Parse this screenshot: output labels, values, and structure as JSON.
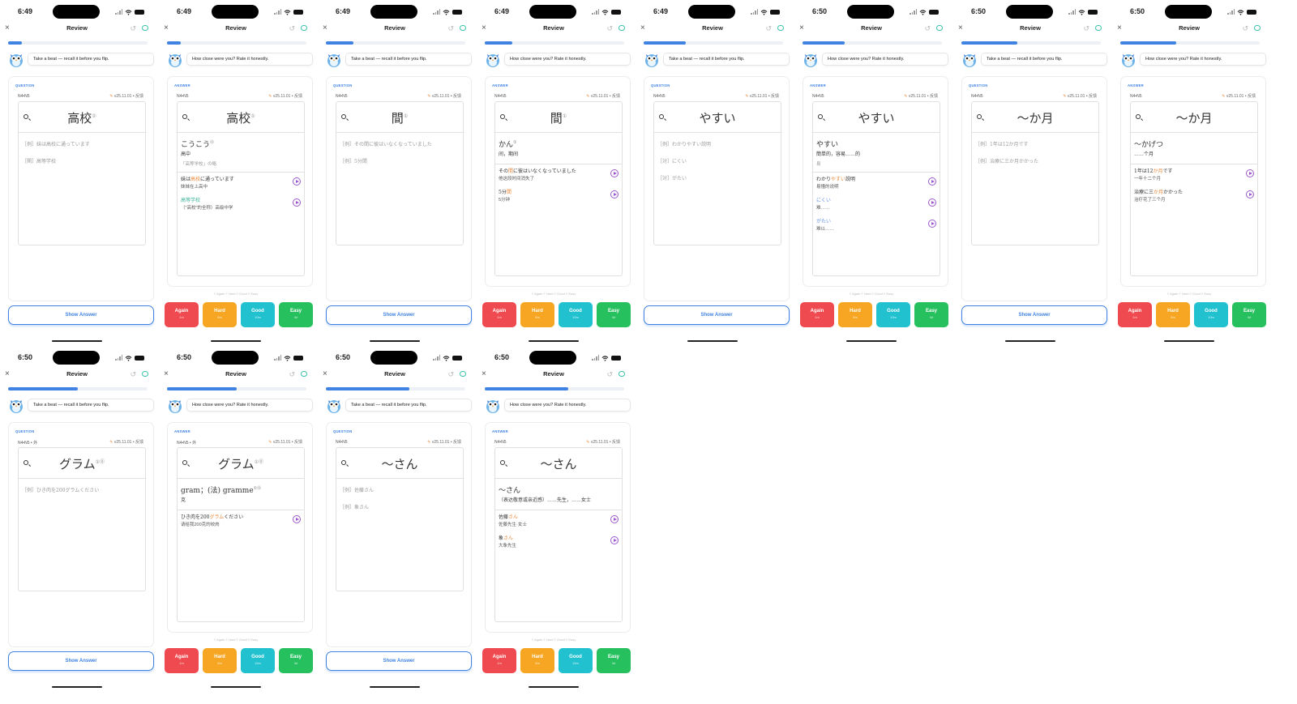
{
  "nav": {
    "title": "Review",
    "close": "×",
    "undo": "↺"
  },
  "prompts": {
    "question": "Take a beat — recall it before you flip.",
    "answer": "How close were you? Rate it honestly."
  },
  "labels": {
    "question": "QUESTION",
    "answer": "ANSWER",
    "show_answer": "Show Answer",
    "legend": "≡ Again  ≡ Hard  ≡ Good  ≡ Easy",
    "magnifier": "search"
  },
  "rating": [
    {
      "label": "Again",
      "interval": "1m"
    },
    {
      "label": "Hard",
      "interval": "6m"
    },
    {
      "label": "Good",
      "interval": "10m"
    },
    {
      "label": "Easy",
      "interval": "4d"
    }
  ],
  "colors": {
    "accent": "#3f82e2",
    "again": "#ef4a4f",
    "hard": "#f6a623",
    "good": "#22c1cf",
    "easy": "#27c05e",
    "highlight": "#e8883a",
    "play": "#9b59d0"
  },
  "screens": [
    {
      "side": "question",
      "time": "6:49",
      "progress": 0.1,
      "level": "N4•N5",
      "version": "v25.11.01 • 反馈",
      "word": "高校",
      "sup": "①",
      "examples": [
        "［例］妹は高校に通っています",
        "［関］高等学校"
      ]
    },
    {
      "side": "answer",
      "time": "6:49",
      "progress": 0.1,
      "level": "N4•N5",
      "version": "v25.11.01 • 反馈",
      "word": "高校",
      "sup": "①",
      "reading": "こうこう",
      "rsup": "⓪",
      "meaning": "高中",
      "note": "「高等学校」の略",
      "items": [
        {
          "jp_pre": "妹は",
          "jp_hl": "高校",
          "jp_post": "に通っています",
          "cn": "妹妹在上高中",
          "color": ""
        },
        {
          "jp_pre": "",
          "jp_hl": "",
          "jp_post": "高等学校",
          "cn": "（\"高校\"的全称）高级中学",
          "color": "grn"
        }
      ]
    },
    {
      "side": "question",
      "time": "6:49",
      "progress": 0.2,
      "level": "N4•N5",
      "version": "v25.11.01 • 反馈",
      "word": "間",
      "sup": "①",
      "examples": [
        "［例］その間に彼はいなくなっていました",
        "［例］5分間"
      ]
    },
    {
      "side": "answer",
      "time": "6:49",
      "progress": 0.2,
      "level": "N4•N5",
      "version": "v25.11.01 • 反馈",
      "word": "間",
      "sup": "①",
      "reading": "かん",
      "rsup": "①",
      "meaning": "间，期间",
      "note": "",
      "items": [
        {
          "jp_pre": "その",
          "jp_hl": "間",
          "jp_post": "に彼はいなくなっていました",
          "cn": "他这段时间消失了",
          "color": ""
        },
        {
          "jp_pre": "5分",
          "jp_hl": "間",
          "jp_post": "",
          "cn": "5分钟",
          "color": ""
        }
      ]
    },
    {
      "side": "question",
      "time": "6:49",
      "progress": 0.3,
      "level": "N4•N5",
      "version": "v25.11.01 • 反馈",
      "word": "やすい",
      "sup": "",
      "examples": [
        "［例］わかりやすい説明",
        "［対］にくい",
        "［対］がたい"
      ]
    },
    {
      "side": "answer",
      "time": "6:50",
      "progress": 0.3,
      "level": "N4•N5",
      "version": "v25.11.01 • 反馈",
      "word": "やすい",
      "sup": "",
      "reading": "やすい",
      "rsup": "",
      "meaning": "簡単的，容易……的",
      "note": "易",
      "items": [
        {
          "jp_pre": "わかり",
          "jp_hl": "やすい",
          "jp_post": "説明",
          "cn": "易懂的说明",
          "color": ""
        },
        {
          "jp_pre": "",
          "jp_hl": "",
          "jp_post": "にくい",
          "cn": "难……",
          "color": "blu"
        },
        {
          "jp_pre": "",
          "jp_hl": "",
          "jp_post": "がたい",
          "cn": "难以……",
          "color": "blu"
        }
      ]
    },
    {
      "side": "question",
      "time": "6:50",
      "progress": 0.4,
      "level": "N4•N5",
      "version": "v25.11.01 • 反馈",
      "word": "～か月",
      "sup": "",
      "examples": [
        "［例］1年は12か月です",
        "［例］治療に三か月かかった"
      ]
    },
    {
      "side": "answer",
      "time": "6:50",
      "progress": 0.4,
      "level": "N4•N5",
      "version": "v25.11.01 • 反馈",
      "word": "～か月",
      "sup": "",
      "reading": "～かげつ",
      "rsup": "",
      "meaning": "……个月",
      "note": "",
      "items": [
        {
          "jp_pre": "1年は12",
          "jp_hl": "か月",
          "jp_post": "です",
          "cn": "一年十二个月",
          "color": ""
        },
        {
          "jp_pre": "治療に三",
          "jp_hl": "か月",
          "jp_post": "かかった",
          "cn": "治疗花了三个月",
          "color": ""
        }
      ]
    },
    {
      "side": "question",
      "time": "6:50",
      "progress": 0.5,
      "level": "N4•N5 • 外",
      "version": "v25.11.01 • 反馈",
      "word": "グラム",
      "sup": "①⓪",
      "examples": [
        "［例］ひき肉を200グラムください"
      ]
    },
    {
      "side": "answer",
      "time": "6:50",
      "progress": 0.5,
      "level": "N4•N5 • 外",
      "version": "v25.11.01 • 反馈",
      "word": "グラム",
      "sup": "①⓪",
      "reading": "gram；(法) gramme",
      "rsup": "①⓪",
      "meaning": "克",
      "note": "",
      "items": [
        {
          "jp_pre": "ひき肉を200",
          "jp_hl": "グラム",
          "jp_post": "ください",
          "cn": "请给我200克的绞肉",
          "color": ""
        }
      ]
    },
    {
      "side": "question",
      "time": "6:50",
      "progress": 0.6,
      "level": "N4•N5",
      "version": "v25.11.01 • 反馈",
      "word": "～さん",
      "sup": "",
      "examples": [
        "［例］佐藤さん",
        "［例］象さん"
      ]
    },
    {
      "side": "answer",
      "time": "6:50",
      "progress": 0.6,
      "level": "N4•N5",
      "version": "v25.11.01 • 反馈",
      "word": "～さん",
      "sup": "",
      "reading": "～さん",
      "rsup": "",
      "meaning": "（表达敬意或亲近感）……先生，……女士",
      "note": "",
      "items": [
        {
          "jp_pre": "佐藤",
          "jp_hl": "さん",
          "jp_post": "",
          "cn": "佐藤先生·女士",
          "color": ""
        },
        {
          "jp_pre": "象",
          "jp_hl": "さん",
          "jp_post": "",
          "cn": "大象先生",
          "color": ""
        }
      ]
    }
  ]
}
